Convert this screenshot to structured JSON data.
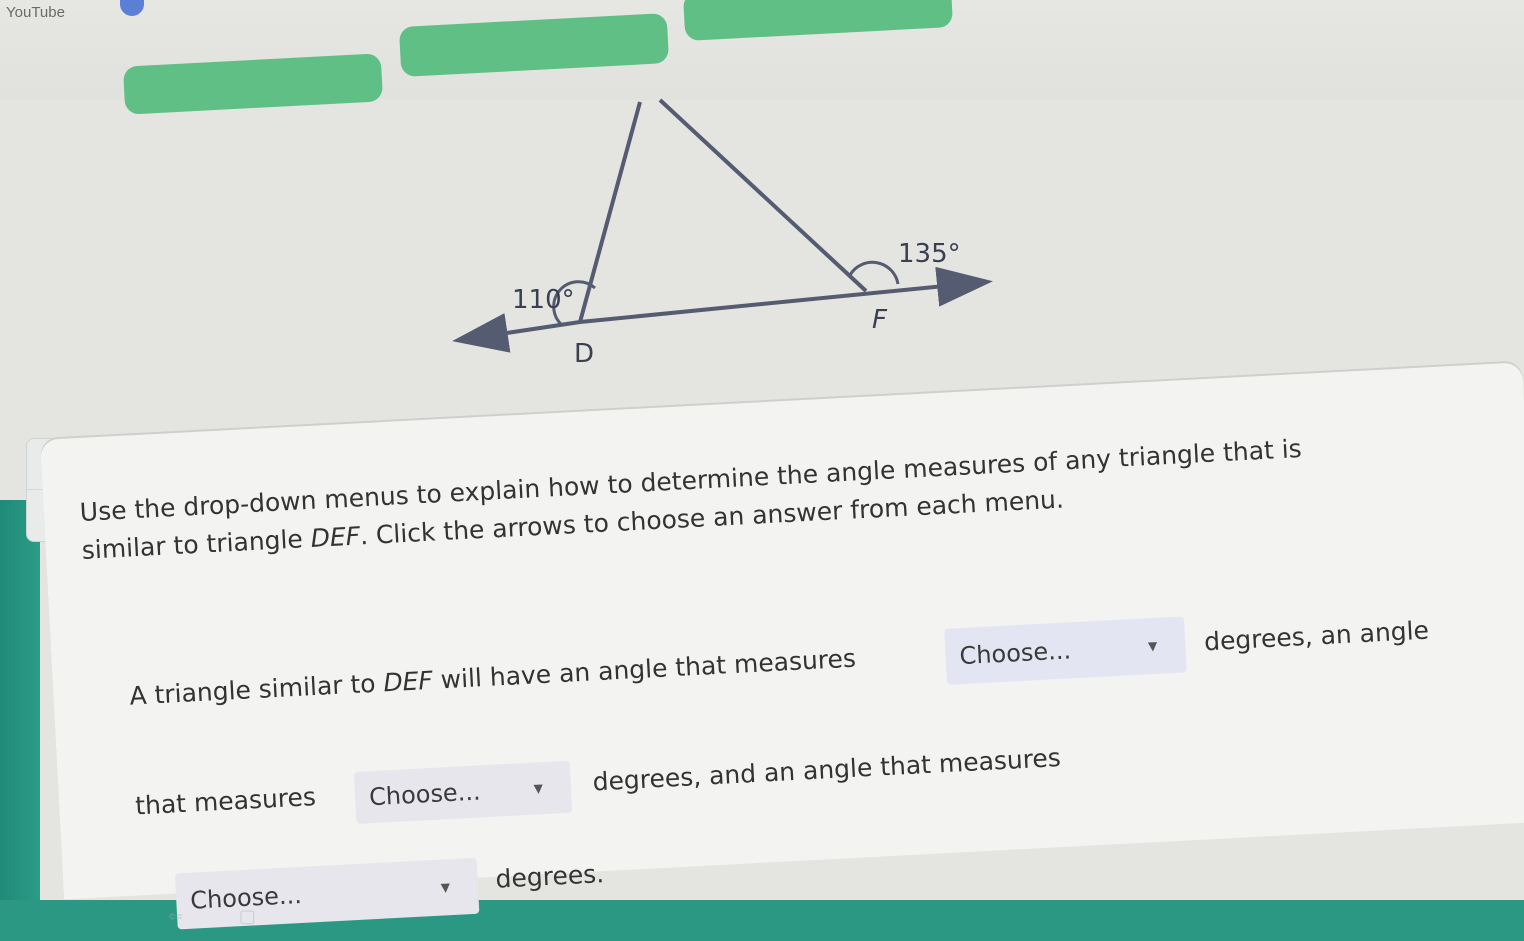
{
  "browser": {
    "tab_title": "YouTube"
  },
  "diagram": {
    "angle_d_label": "110°",
    "angle_f_label": "135°",
    "vertex_d": "D",
    "vertex_f": "F"
  },
  "calculator": {
    "keys": [
      "−",
      "×",
      "+",
      "÷"
    ]
  },
  "question": {
    "instructions_part1": "Use the drop-down menus to explain how to determine the angle measures of any triangle that is",
    "instructions_part2_pre": "similar to triangle ",
    "instructions_part2_italic": "DEF",
    "instructions_part2_post": ". Click the arrows to choose an answer from each menu.",
    "line1_pre": "A triangle similar to ",
    "line1_italic": "DEF",
    "line1_post": " will have an angle that measures",
    "line1_after": "degrees, an angle",
    "line2_pre": "that measures",
    "line2_after": "degrees, and an angle that measures",
    "line3_after": "degrees."
  },
  "dropdowns": {
    "first": {
      "selected": "Choose..."
    },
    "second": {
      "selected": "Choose..."
    },
    "third": {
      "selected": "Choose..."
    }
  },
  "colors": {
    "accent_green": "#5fbf85",
    "teal": "#2a9882",
    "dropdown_bg": "#e6e6ec"
  }
}
